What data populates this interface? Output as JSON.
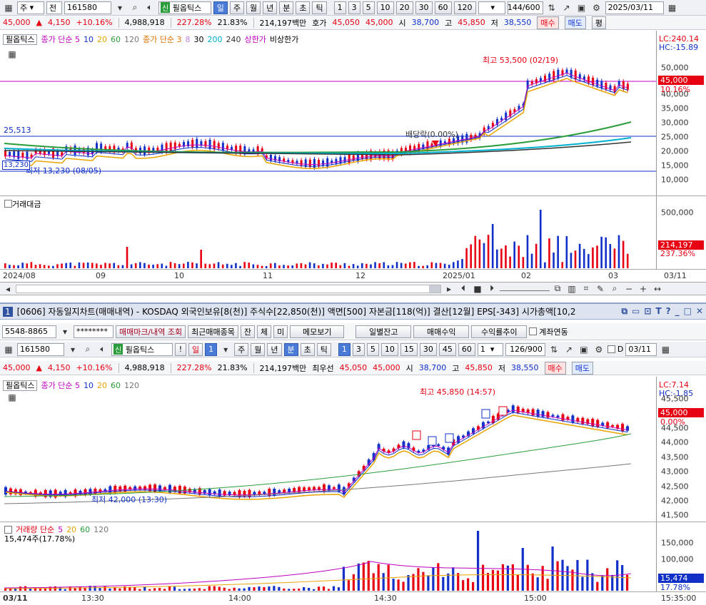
{
  "top_toolbar": {
    "market": "주",
    "period_prefix": "전",
    "code": "161580",
    "badge": "신",
    "name": "필옵틱스",
    "periods": [
      "일",
      "주",
      "월",
      "년",
      "분",
      "초",
      "틱"
    ],
    "nums": [
      "1",
      "3",
      "5",
      "10",
      "20",
      "30",
      "60",
      "120"
    ],
    "count": "144",
    "count_max": "/600",
    "date": "2025/03/11"
  },
  "quote": {
    "price": "45,000",
    "change": "4,150",
    "rate": "+10.16%",
    "volume": "4,988,918",
    "vol_rate": "227.28%",
    "turnover": "21.83%",
    "amount": "214,197백만",
    "ask_label": "호가",
    "ask1": "45,050",
    "ask2": "45,000",
    "open_label": "시",
    "open": "38,700",
    "high_label": "고",
    "high": "45,850",
    "low_label": "저",
    "low": "38,550",
    "buy": "매수",
    "sell": "매도",
    "eval": "평"
  },
  "daily_chart": {
    "legend": [
      "필옵틱스",
      "종가 단순 5",
      "10",
      "20",
      "60",
      "120",
      "종가 단순 3",
      "8",
      "30",
      "200",
      "240",
      "상한가",
      "비상한가"
    ],
    "lc": "LC:240.14",
    "hc": "HC:-15.89",
    "y_ticks": [
      "50,000",
      "45,000",
      "40,000",
      "35,000",
      "30,000",
      "25,000",
      "20,000",
      "15,000",
      "10,000"
    ],
    "price_tag": "45,000",
    "pct_tag": "10.16%",
    "high_note": "최고 53,500 (02/19)",
    "low_note": "최저 13,230 (08/05)",
    "div_note": "배당락(0.00%)",
    "level_line": "25,513",
    "left_tag": "13,230"
  },
  "daily_volume": {
    "label": "거래대금",
    "y_ticks": [
      "500,000",
      "250,000"
    ],
    "tag": "214,197",
    "tag2": "237.36%",
    "x_ticks": [
      "2024/08",
      "09",
      "10",
      "11",
      "12",
      "2025/01",
      "02",
      "03"
    ],
    "x_end": "03/11"
  },
  "lower_window": {
    "num": "1",
    "title": "[0606] 자동일지차트(매매내역) - KOSDAQ 외국인보유[8(천)] 주식수[22,850(천)] 액면[500] 자본금[118(억)] 결산[12월] EPS[-343] 시가총액[10,2",
    "account": "5548-8865",
    "password": "********",
    "btn_mark": "매매마크/내역 조회",
    "btn_recent": "최근매매종목",
    "btn_jan": "잔",
    "btn_che": "체",
    "btn_mi": "미",
    "btn_memo": "메모보기",
    "btn_daily": "일별잔고",
    "btn_profit": "매매수익",
    "btn_trend": "수익률추이",
    "chk_link": "계좌연동"
  },
  "lower_toolbar": {
    "code": "161580",
    "badge": "신",
    "name": "필옵틱스",
    "excl": "!",
    "period": "일",
    "period_num": "1",
    "periods": [
      "주",
      "월",
      "년",
      "분",
      "초",
      "틱"
    ],
    "nums": [
      "1",
      "3",
      "5",
      "10",
      "15",
      "30",
      "45",
      "60"
    ],
    "sel": "1",
    "count": "126",
    "count_max": "/900",
    "d_label": "D",
    "date": "03/11"
  },
  "lower_quote": {
    "price": "45,000",
    "change": "4,150",
    "rate": "+10.16%",
    "volume": "4,988,918",
    "vol_rate": "227.28%",
    "turnover": "21.83%",
    "amount": "214,197백만",
    "ask_label": "최우선",
    "ask1": "45,050",
    "ask2": "45,000",
    "open_label": "시",
    "open": "38,700",
    "high_label": "고",
    "high": "45,850",
    "low_label": "저",
    "low": "38,550",
    "buy": "매수",
    "sell": "매도"
  },
  "intraday_chart": {
    "legend": [
      "필옵틱스",
      "종가 단순 5",
      "10",
      "20",
      "60",
      "120"
    ],
    "lc": "LC:7.14",
    "hc": "HC:-1.85",
    "y_ticks": [
      "45,500",
      "44,500",
      "44,000",
      "43,500",
      "43,000",
      "42,500",
      "42,000",
      "41,500"
    ],
    "price_tag": "45,000",
    "pct_tag": "0.00%",
    "high_note": "최고 45,850 (14:57)",
    "low_note": "최저 42,000 (13:30)"
  },
  "intraday_volume": {
    "label": "거래량 단순",
    "ma": [
      "5",
      "20",
      "60",
      "120"
    ],
    "sub": "15,474주(17.78%)",
    "y_ticks": [
      "150,000",
      "100,000"
    ],
    "tag": "15,474",
    "tag2": "17.78%",
    "x_ticks": [
      "03/11",
      "13:30",
      "14:00",
      "14:30",
      "15:00"
    ],
    "x_end": "15:35:00"
  },
  "colors": {
    "up": "#e60012",
    "down": "#1030c8",
    "ma5": "#c000c0",
    "ma10": "#1030c8",
    "ma20": "#e8a400",
    "ma60": "#2a9d3a",
    "ma120": "#777777"
  }
}
